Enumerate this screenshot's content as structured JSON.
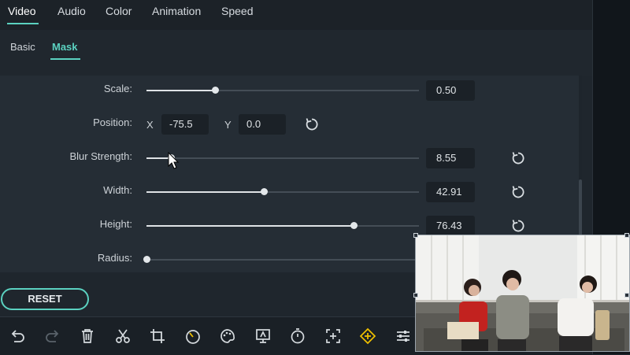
{
  "top_tabs": [
    "Video",
    "Audio",
    "Color",
    "Animation",
    "Speed"
  ],
  "sub_tabs": [
    "Basic",
    "Mask"
  ],
  "controls": {
    "scale": {
      "label": "Scale:",
      "value": "0.50",
      "level": 0.25
    },
    "position": {
      "label": "Position:",
      "x_label": "X",
      "x_value": "-75.5",
      "y_label": "Y",
      "y_value": "0.0"
    },
    "blur": {
      "label": "Blur Strength:",
      "value": "8.55",
      "level": 0.09
    },
    "width": {
      "label": "Width:",
      "value": "42.91",
      "level": 0.43
    },
    "height": {
      "label": "Height:",
      "value": "76.43",
      "level": 0.76
    },
    "radius": {
      "label": "Radius:",
      "value": "",
      "level": 0.0
    }
  },
  "reset_label": "RESET",
  "toolbar_icons": [
    "undo-icon",
    "redo-icon",
    "delete-icon",
    "cut-icon",
    "crop-icon",
    "speed-icon",
    "color-icon",
    "stabilize-icon",
    "timer-icon",
    "zoom-icon",
    "keyframe-icon",
    "adjust-icon"
  ],
  "colors": {
    "accent": "#5bd1c0",
    "panel": "#252d35",
    "background": "#1f262d"
  }
}
